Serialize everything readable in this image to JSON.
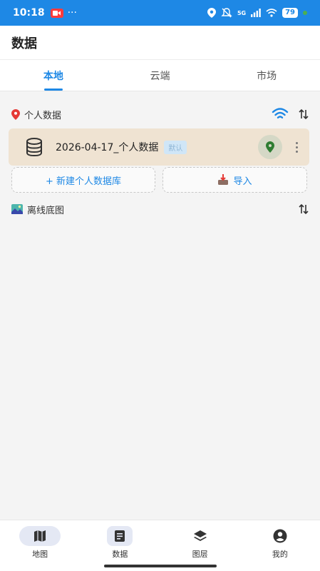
{
  "status_bar": {
    "time": "10:18",
    "more": "···",
    "network": "5G",
    "battery": "79"
  },
  "header": {
    "title": "数据"
  },
  "tabs": [
    {
      "label": "本地",
      "active": true
    },
    {
      "label": "云端",
      "active": false
    },
    {
      "label": "市场",
      "active": false
    }
  ],
  "personal": {
    "label": "个人数据",
    "icon": "location-pin-icon",
    "items": [
      {
        "name": "2026-04-17_个人数据",
        "tag": "默认"
      }
    ],
    "new_button": "+ 新建个人数据库",
    "import_button": "导入"
  },
  "offline": {
    "label": "离线底图",
    "icon": "map-image-icon"
  },
  "bottom_nav": [
    {
      "label": "地图",
      "icon": "map-icon"
    },
    {
      "label": "数据",
      "icon": "data-icon"
    },
    {
      "label": "图层",
      "icon": "layers-icon"
    },
    {
      "label": "我的",
      "icon": "account-icon"
    }
  ],
  "colors": {
    "accent": "#1e88e5",
    "db_item_bg": "#efe3d2",
    "pin_green": "#2e7d32"
  }
}
